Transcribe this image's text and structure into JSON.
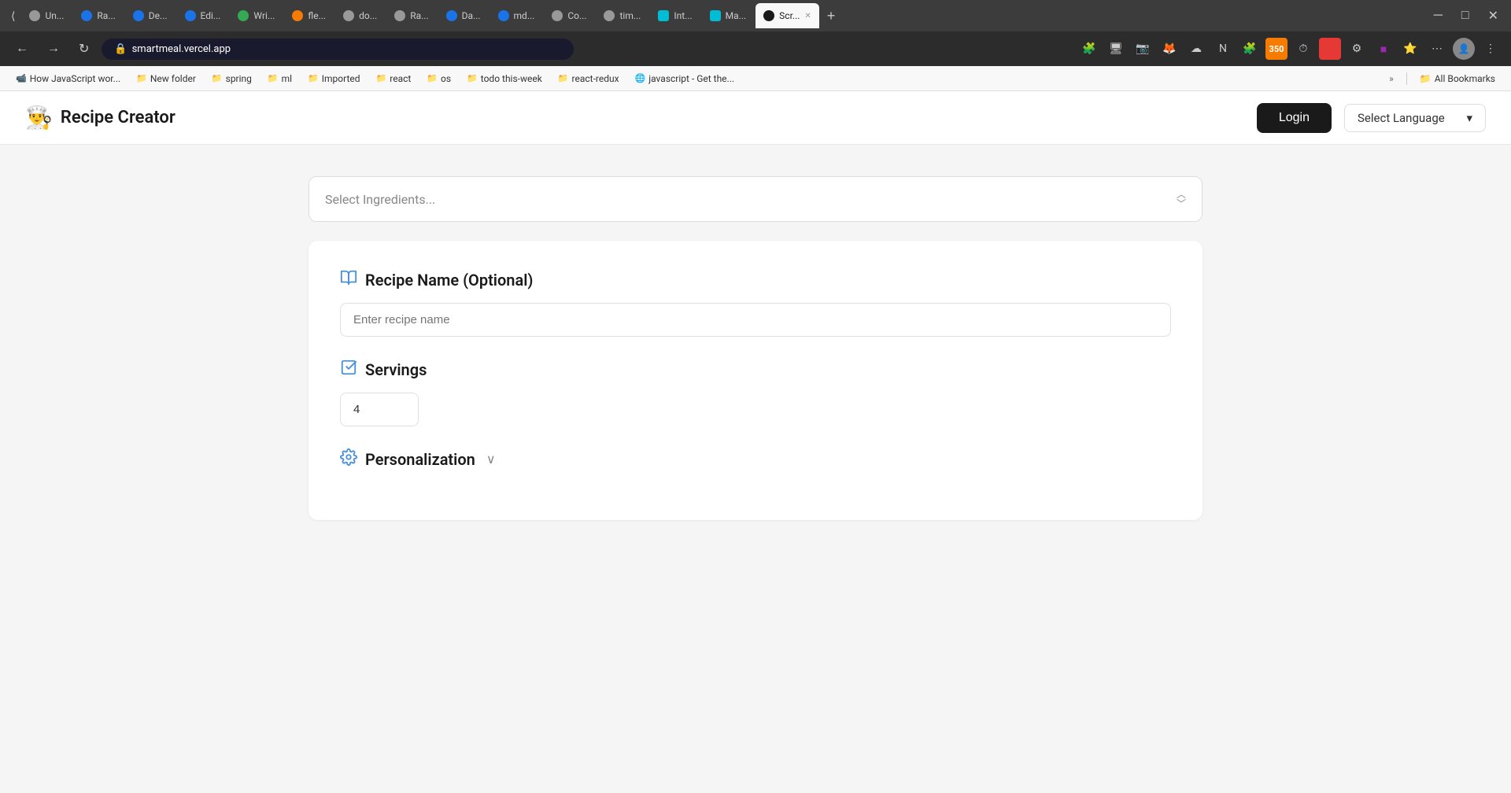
{
  "browser": {
    "tabs": [
      {
        "id": "t1",
        "label": "Un...",
        "favicon_color": "#2196F3",
        "active": false
      },
      {
        "id": "t2",
        "label": "Ra...",
        "favicon_color": "#1a73e8",
        "active": false
      },
      {
        "id": "t3",
        "label": "De...",
        "favicon_color": "#1a73e8",
        "active": false
      },
      {
        "id": "t4",
        "label": "Edi...",
        "favicon_color": "#1a73e8",
        "active": false
      },
      {
        "id": "t5",
        "label": "Wri...",
        "favicon_color": "#4CAF50",
        "active": false
      },
      {
        "id": "t6",
        "label": "fle...",
        "favicon_color": "#FF6B35",
        "active": false
      },
      {
        "id": "t7",
        "label": "do...",
        "favicon_color": "#777",
        "active": false
      },
      {
        "id": "t8",
        "label": "Ra...",
        "favicon_color": "#777",
        "active": false
      },
      {
        "id": "t9",
        "label": "Da...",
        "favicon_color": "#2196F3",
        "active": false
      },
      {
        "id": "t10",
        "label": "md...",
        "favicon_color": "#4285F4",
        "active": false
      },
      {
        "id": "t11",
        "label": "Co...",
        "favicon_color": "#888",
        "active": false
      },
      {
        "id": "t12",
        "label": "tim...",
        "favicon_color": "#777",
        "active": false
      },
      {
        "id": "t13",
        "label": "Int...",
        "favicon_color": "#00BCD4",
        "active": false
      },
      {
        "id": "t14",
        "label": "Ma...",
        "favicon_color": "#00BCD4",
        "active": false
      },
      {
        "id": "t15",
        "label": "Scr...",
        "favicon_color": "#1a1a1a",
        "active": true
      }
    ],
    "address": "smartmeal.vercel.app",
    "new_tab_label": "+",
    "minimize_label": "─",
    "maximize_label": "□",
    "close_label": "✕"
  },
  "bookmarks": [
    {
      "id": "b1",
      "label": "How JavaScript wor...",
      "icon": "📹"
    },
    {
      "id": "b2",
      "label": "New folder",
      "icon": "📁"
    },
    {
      "id": "b3",
      "label": "spring",
      "icon": "📁"
    },
    {
      "id": "b4",
      "label": "ml",
      "icon": "📁"
    },
    {
      "id": "b5",
      "label": "Imported",
      "icon": "📁"
    },
    {
      "id": "b6",
      "label": "react",
      "icon": "📁"
    },
    {
      "id": "b7",
      "label": "os",
      "icon": "📁"
    },
    {
      "id": "b8",
      "label": "todo this-week",
      "icon": "📁"
    },
    {
      "id": "b9",
      "label": "react-redux",
      "icon": "📁"
    },
    {
      "id": "b10",
      "label": "javascript - Get the...",
      "icon": "🌐"
    }
  ],
  "bookmarks_more_label": "»",
  "all_bookmarks_label": "All Bookmarks",
  "header": {
    "logo_icon": "👨‍🍳",
    "title": "Recipe Creator",
    "login_label": "Login",
    "language_select_label": "Select Language",
    "language_chevron": "▾"
  },
  "main": {
    "ingredients_placeholder": "Select Ingredients...",
    "ingredients_arrow_up": "︿",
    "ingredients_arrow_down": "﹀",
    "form": {
      "recipe_name_section": {
        "icon": "📖",
        "title": "Recipe Name (Optional)",
        "input_placeholder": "Enter recipe name"
      },
      "servings_section": {
        "icon": "📋",
        "title": "Servings",
        "value": "4"
      },
      "personalization_section": {
        "icon": "⚙",
        "title": "Personalization",
        "chevron": "∨"
      }
    }
  }
}
